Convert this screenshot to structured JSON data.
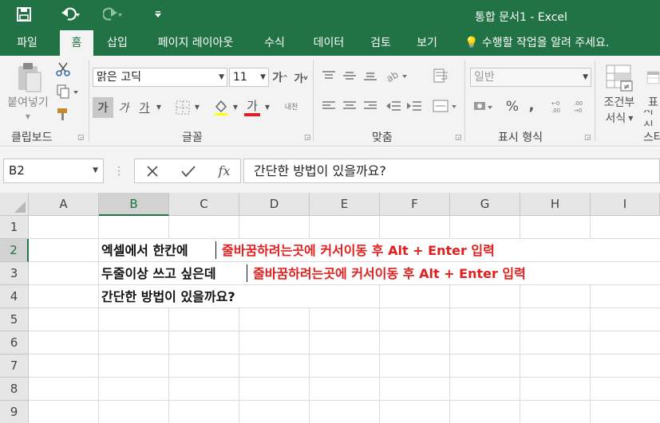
{
  "window": {
    "title": "통합 문서1 - Excel"
  },
  "quick_access": {
    "save_icon": "save-icon",
    "undo_icon": "undo-icon",
    "redo_icon": "redo-icon",
    "customize_icon": "customize-qat-icon"
  },
  "tabs": [
    {
      "label": "파일"
    },
    {
      "label": "홈"
    },
    {
      "label": "삽입"
    },
    {
      "label": "페이지 레이아웃"
    },
    {
      "label": "수식"
    },
    {
      "label": "데이터"
    },
    {
      "label": "검토"
    },
    {
      "label": "보기"
    }
  ],
  "tell_me": "수행할 작업을 알려 주세요.",
  "ribbon": {
    "clipboard": {
      "paste_label": "붙여넣기",
      "group_label": "클립보드"
    },
    "font": {
      "font_name": "맑은 고딕",
      "font_size": "11",
      "grow_label": "가",
      "shrink_label": "가",
      "bold_label": "가",
      "italic_label": "가",
      "underline_label": "가",
      "font_color_label": "가",
      "phonetic_label": "내천",
      "group_label": "글꼴",
      "font_color": "#e0201f"
    },
    "alignment": {
      "group_label": "맞춤"
    },
    "number": {
      "format": "일반",
      "percent": "%",
      "comma": ",",
      "group_label": "표시 형식"
    },
    "styles": {
      "conditional_label_1": "조건부",
      "conditional_label_2": "서식",
      "table_label_1": "표",
      "table_label_2": "서식",
      "group_label": "스타"
    }
  },
  "formula_bar": {
    "name_box": "B2",
    "cancel_icon": "cancel-icon",
    "enter_icon": "enter-icon",
    "fx_label": "fx",
    "content": "간단한 방법이 있을까요?"
  },
  "grid": {
    "columns": [
      "A",
      "B",
      "C",
      "D",
      "E",
      "F",
      "G",
      "H",
      "I"
    ],
    "rows": [
      "1",
      "2",
      "3",
      "4",
      "5",
      "6",
      "7",
      "8",
      "9"
    ],
    "cells": {
      "row2_black": "엑셀에서 한칸에",
      "row2_red": "줄바꿈하려는곳에 커서이동 후 Alt + Enter 입력",
      "row3_black": "두줄이상 쓰고 싶은데",
      "row3_red": "줄바꿈하려는곳에 커서이동 후 Alt + Enter 입력",
      "row4_black": "간단한 방법이 있을까요?"
    }
  },
  "colors": {
    "excel_green": "#217346",
    "red_text": "#e0201f"
  }
}
